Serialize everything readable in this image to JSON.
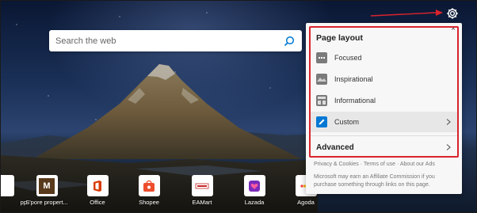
{
  "search": {
    "placeholder": "Search the web"
  },
  "quick_links": [
    {
      "label": "pp",
      "letter": "",
      "color": "#ffffff"
    },
    {
      "label": "S'pore propert...",
      "letter": "M",
      "color": "#5a3a1c"
    },
    {
      "label": "Office",
      "letter": "",
      "color": "#d83b01"
    },
    {
      "label": "Shopee",
      "letter": "",
      "color": "#ee4d2d"
    },
    {
      "label": "EAMart",
      "letter": "",
      "color": "#c62828"
    },
    {
      "label": "Lazada",
      "letter": "",
      "color": "#7b2bbb"
    },
    {
      "label": "Agoda",
      "letter": "",
      "color": "#2f3a8f"
    }
  ],
  "settings_panel": {
    "title": "Page layout",
    "close_label": "×",
    "options": [
      {
        "label": "Focused",
        "icon": "focused-layout-icon",
        "selected": false
      },
      {
        "label": "Inspirational",
        "icon": "inspirational-layout-icon",
        "selected": false
      },
      {
        "label": "Informational",
        "icon": "informational-layout-icon",
        "selected": false
      },
      {
        "label": "Custom",
        "icon": "custom-layout-icon",
        "selected": true
      }
    ],
    "advanced_label": "Advanced",
    "footer_links": [
      "Privacy & Cookies",
      "Terms of use",
      "About our Ads"
    ],
    "footer_separator": "·",
    "footer_note": "Microsoft may earn an Affiliate Commission if you purchase something through links on this page."
  },
  "colors": {
    "highlight_border": "#d9232d",
    "accent": "#0078d4",
    "annotation_arrow": "#d9232d"
  }
}
